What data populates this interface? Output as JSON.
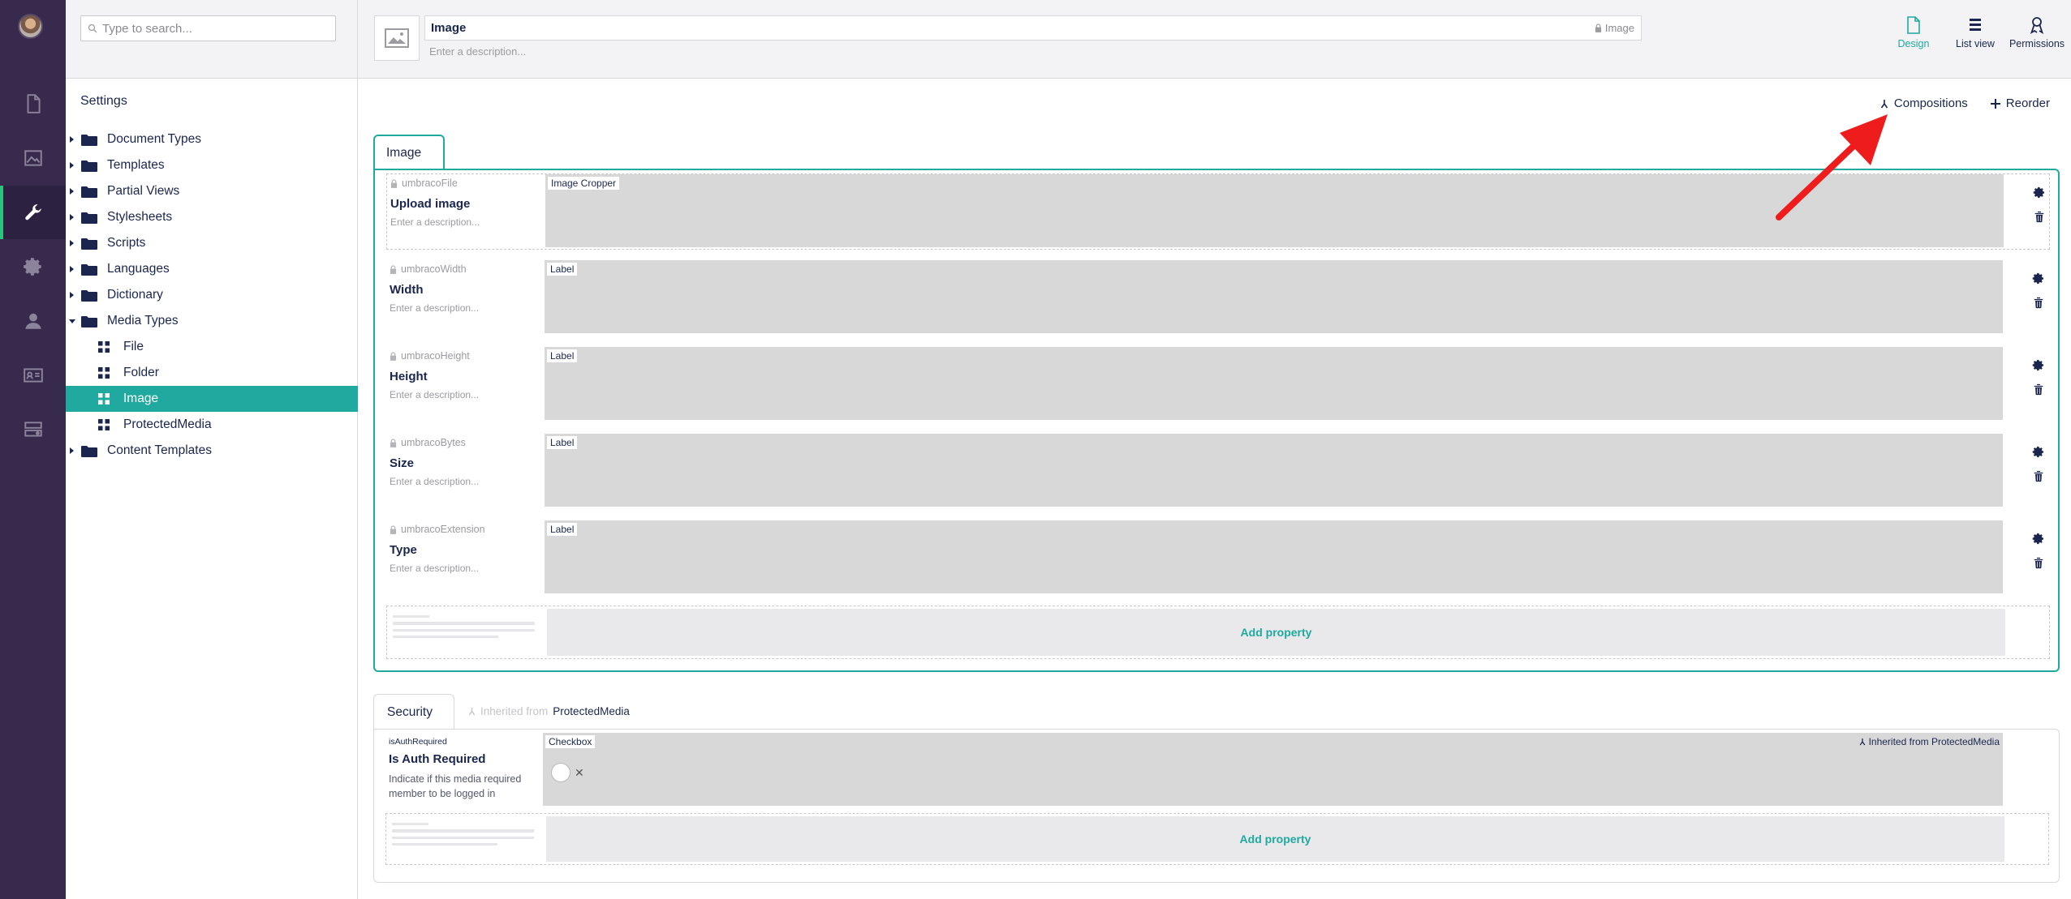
{
  "tree": {
    "search_placeholder": "Type to search...",
    "section_title": "Settings",
    "items": [
      {
        "label": "Document Types",
        "kind": "folder",
        "expanded": false
      },
      {
        "label": "Templates",
        "kind": "folder",
        "expanded": false
      },
      {
        "label": "Partial Views",
        "kind": "folder",
        "expanded": false
      },
      {
        "label": "Stylesheets",
        "kind": "folder",
        "expanded": false
      },
      {
        "label": "Scripts",
        "kind": "folder",
        "expanded": false
      },
      {
        "label": "Languages",
        "kind": "folder",
        "expanded": false
      },
      {
        "label": "Dictionary",
        "kind": "folder",
        "expanded": false
      },
      {
        "label": "Media Types",
        "kind": "folder",
        "expanded": true
      },
      {
        "label": "File",
        "kind": "media-type"
      },
      {
        "label": "Folder",
        "kind": "media-type"
      },
      {
        "label": "Image",
        "kind": "media-type",
        "selected": true
      },
      {
        "label": "ProtectedMedia",
        "kind": "media-type"
      },
      {
        "label": "Content Templates",
        "kind": "folder",
        "expanded": false
      }
    ]
  },
  "rail": {
    "sections": [
      "content-icon",
      "media-icon",
      "settings-wrench-icon",
      "packages-gear-icon",
      "users-icon",
      "members-icon",
      "forms-icon"
    ],
    "active": "settings-wrench-icon"
  },
  "header": {
    "name": "Image",
    "alias": "Image",
    "description_placeholder": "Enter a description...",
    "apps": [
      {
        "label": "Design",
        "icon": "document-icon",
        "active": true
      },
      {
        "label": "List view",
        "icon": "list-icon",
        "active": false
      },
      {
        "label": "Permissions",
        "icon": "ribbon-icon",
        "active": false
      }
    ]
  },
  "actions": {
    "compositions": "Compositions",
    "reorder": "Reorder"
  },
  "group_image": {
    "tab_label": "Image",
    "properties": [
      {
        "alias": "umbracoFile",
        "name": "Upload image",
        "description": "Enter a description...",
        "editor": "Image Cropper"
      },
      {
        "alias": "umbracoWidth",
        "name": "Width",
        "description": "Enter a description...",
        "editor": "Label"
      },
      {
        "alias": "umbracoHeight",
        "name": "Height",
        "description": "Enter a description...",
        "editor": "Label"
      },
      {
        "alias": "umbracoBytes",
        "name": "Size",
        "description": "Enter a description...",
        "editor": "Label"
      },
      {
        "alias": "umbracoExtension",
        "name": "Type",
        "description": "Enter a description...",
        "editor": "Label"
      }
    ],
    "add_property": "Add property"
  },
  "group_security": {
    "tab_label": "Security",
    "inherited_prefix": "Inherited from",
    "inherited_source": "ProtectedMedia",
    "property": {
      "alias": "isAuthRequired",
      "name": "Is Auth Required",
      "description": "Indicate if this media required member to be logged in",
      "editor": "Checkbox",
      "inherited_note": "Inherited from ProtectedMedia"
    },
    "add_property": "Add property"
  },
  "colors": {
    "rail": "#372a4c",
    "accent": "#1fa99f",
    "annotation_arrow": "#ee1c1c"
  }
}
